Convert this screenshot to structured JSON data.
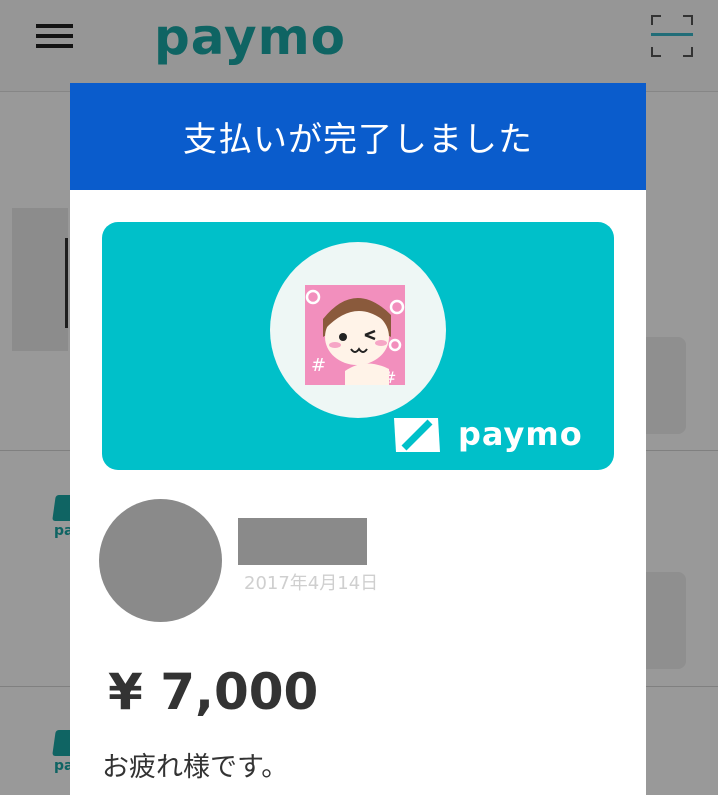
{
  "app": {
    "logo_text": "paymo",
    "brand_color": "#1aa7a5"
  },
  "dialog": {
    "title": "支払いが完了しました",
    "header_color": "#0a5ccc",
    "card": {
      "background_color": "#00c0c9",
      "logo_text": "paymo"
    },
    "payment": {
      "date": "2017年4月14日",
      "amount": "¥ 7,000",
      "message": "お疲れ様です。"
    }
  },
  "background_list": {
    "logo_label": "pa"
  }
}
